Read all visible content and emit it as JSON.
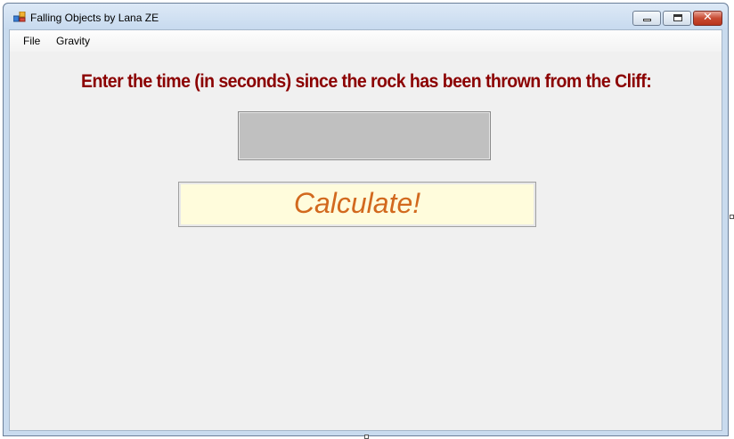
{
  "window": {
    "title": "Falling Objects by Lana ZE",
    "controls": {
      "minimize": "minimize-icon",
      "maximize": "maximize-icon",
      "close": "close-icon"
    }
  },
  "menu": {
    "items": [
      {
        "label": "File"
      },
      {
        "label": "Gravity"
      }
    ]
  },
  "form": {
    "prompt": "Enter the time (in seconds) since the rock has been thrown from the Cliff:",
    "time_value": "",
    "calculate_label": "Calculate!"
  },
  "colors": {
    "prompt": "#8b0000",
    "button_text": "#d2691e",
    "button_bg": "#fffcdc",
    "input_bg": "#c0c0c0"
  }
}
